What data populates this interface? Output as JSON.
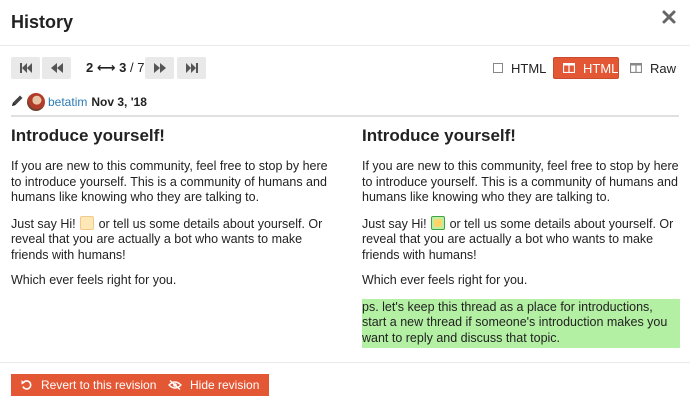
{
  "modal": {
    "title": "History",
    "close_icon": "close-icon"
  },
  "revision_nav": {
    "first_icon": "fast-backward-icon",
    "prev_icon": "backward-icon",
    "from": "2",
    "arrow": "⟷",
    "to": "3",
    "separator": "/",
    "total": "7",
    "next_icon": "forward-icon",
    "last_icon": "fast-forward-icon"
  },
  "view_modes": [
    {
      "label": "HTML",
      "icon": "square-icon",
      "active": false
    },
    {
      "label": "HTML",
      "icon": "columns-icon",
      "active": true
    },
    {
      "label": "Raw",
      "icon": "columns-icon",
      "active": false
    }
  ],
  "revision_meta": {
    "editor_icon": "pencil-icon",
    "username": "betatim",
    "date": "Nov 3, '18"
  },
  "left_column": {
    "heading": "Introduce yourself!",
    "para1": "If you are new to this community, feel free to stop by here to introduce yourself. This is a community of humans and humans like knowing who they are talking to.",
    "para2_before": "Just say Hi!",
    "para2_after": "or tell us some details about yourself. Or reveal that you are actually a bot who wants to make friends with humans!",
    "para3": "Which ever feels right for you."
  },
  "right_column": {
    "heading": "Introduce yourself!",
    "para1": "If you are new to this community, feel free to stop by here to introduce yourself. This is a community of humans and humans like knowing who they are talking to.",
    "para2_before": "Just say Hi!",
    "para2_after": "or tell us some details about yourself. Or reveal that you are actually a bot who wants to make friends with humans!",
    "para3": "Which ever feels right for you.",
    "inserted": "ps. let's keep this thread as a place for introductions, start a new thread if someone's introduction makes you want to reply and discuss that topic."
  },
  "footer": {
    "revert_label": "Revert to this revision",
    "revert_icon": "undo-icon",
    "hide_label": "Hide revision",
    "hide_icon": "eye-slash-icon"
  },
  "colors": {
    "accent": "#e45735",
    "inserted_bg": "#b4f0a4",
    "link": "#2a7bb4",
    "nav_button_bg": "#e9e9e9"
  }
}
